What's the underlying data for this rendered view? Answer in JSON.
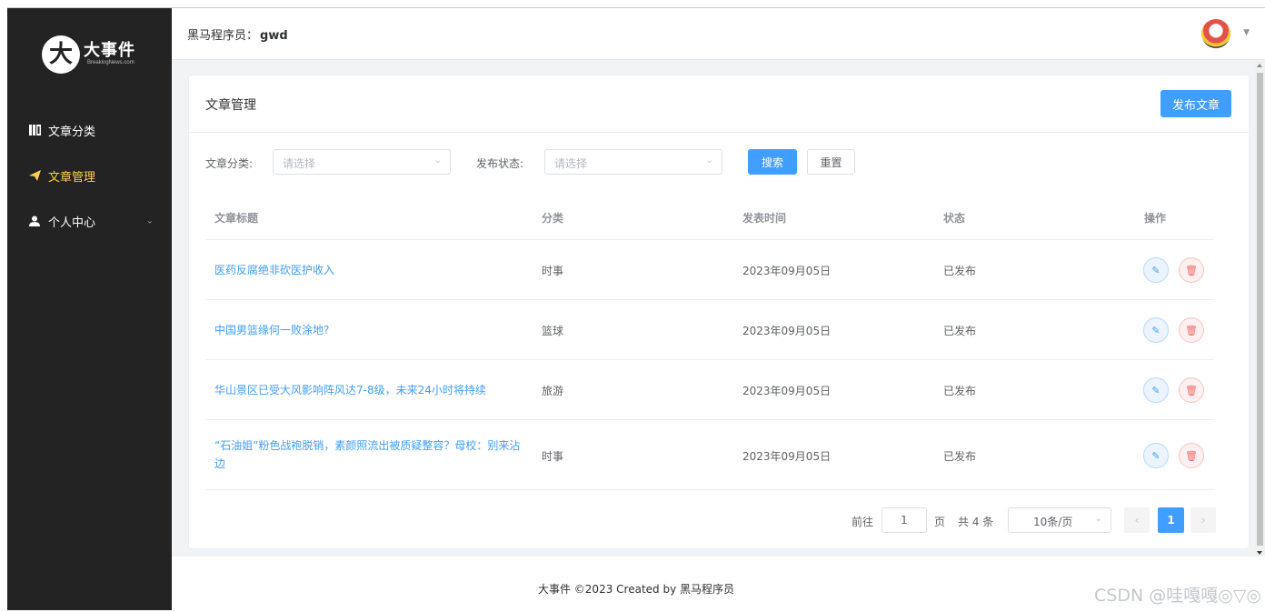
{
  "brand": {
    "logo_glyph": "大",
    "name": "大事件",
    "tagline": "BreakingNews.com"
  },
  "sidebar": {
    "items": [
      {
        "label": "文章分类",
        "icon": "book-icon",
        "active": false
      },
      {
        "label": "文章管理",
        "icon": "paper-plane-icon",
        "active": true
      },
      {
        "label": "个人中心",
        "icon": "user-icon",
        "active": false,
        "expandable": true
      }
    ]
  },
  "header": {
    "prefix": "黑马程序员：",
    "username": "gwd",
    "dropdown_icon": "caret-down-icon"
  },
  "card": {
    "title": "文章管理",
    "publish_label": "发布文章"
  },
  "filter": {
    "category_label": "文章分类:",
    "category_placeholder": "请选择",
    "state_label": "发布状态:",
    "state_placeholder": "请选择",
    "search_label": "搜索",
    "reset_label": "重置"
  },
  "table": {
    "columns": [
      "文章标题",
      "分类",
      "发表时间",
      "状态",
      "操作"
    ],
    "rows": [
      {
        "title": "医药反腐绝非砍医护收入",
        "category": "时事",
        "date": "2023年09月05日",
        "state": "已发布"
      },
      {
        "title": "中国男篮缘何一败涂地?",
        "category": "篮球",
        "date": "2023年09月05日",
        "state": "已发布"
      },
      {
        "title": "华山景区已受大风影响阵风达7-8级，未来24小时将持续",
        "category": "旅游",
        "date": "2023年09月05日",
        "state": "已发布"
      },
      {
        "title": "“石油姐”粉色战袍脱销，素颜照流出被质疑整容？母校：别来沾边",
        "category": "时事",
        "date": "2023年09月05日",
        "state": "已发布"
      }
    ],
    "edit_icon": "edit-icon",
    "delete_icon": "trash-icon"
  },
  "pagination": {
    "goto_label": "前往",
    "page_input": "1",
    "page_unit": "页",
    "total_label": "共 4 条",
    "page_size": "10条/页",
    "current_page": "1",
    "prev_icon": "chevron-left-icon",
    "next_icon": "chevron-right-icon"
  },
  "footer": {
    "text": "大事件 ©2023 Created by 黑马程序员"
  },
  "watermark": "CSDN @哇嘎嘎◎▽◎",
  "colors": {
    "sidebar_bg": "#232323",
    "active": "#ffd04b",
    "primary": "#409eff",
    "danger": "#f56c6c"
  }
}
